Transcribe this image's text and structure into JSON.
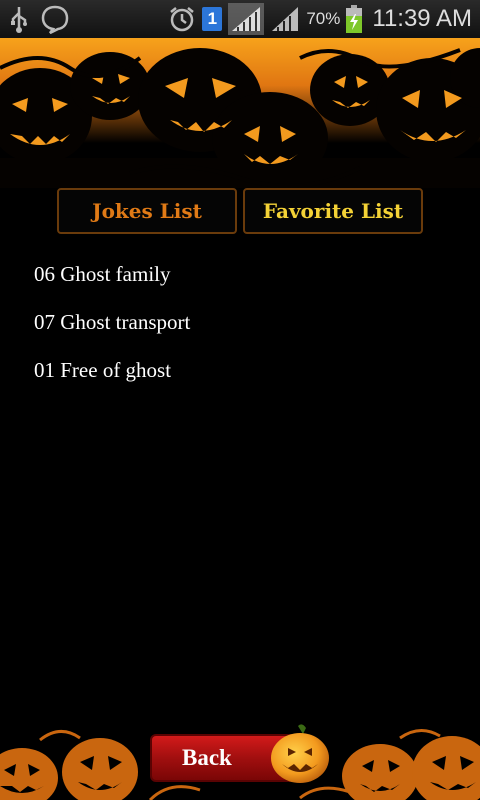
{
  "status_bar": {
    "left_icons": [
      "usb-icon",
      "chat-bubble-icon"
    ],
    "right_icons": [
      "alarm-icon",
      "notification-badge-icon",
      "signal-icon",
      "signal-icon",
      "battery-charging-icon"
    ],
    "notification_badge": "1",
    "battery_percent": "70%",
    "time": "11:39 AM"
  },
  "tabs": {
    "jokes_label": "Jokes List",
    "favorite_label": "Favorite List"
  },
  "jokes": [
    {
      "label": "06 Ghost family"
    },
    {
      "label": "07 Ghost transport"
    },
    {
      "label": "01 Free of ghost"
    }
  ],
  "back_button": {
    "label": "Back"
  },
  "colors": {
    "jokes_tab": "#e07a16",
    "favorite_tab": "#f4d236",
    "back_button": "#b01212",
    "pumpkin_orange": "#f39a1e"
  }
}
